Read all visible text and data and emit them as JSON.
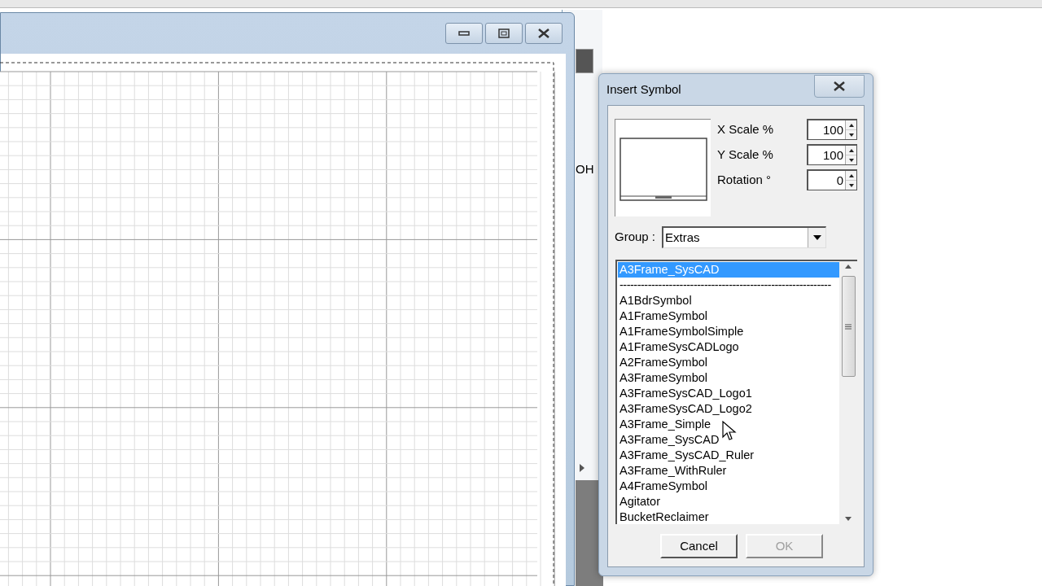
{
  "main_window": {
    "controls": [
      {
        "kind": "minimize"
      },
      {
        "kind": "maximize"
      },
      {
        "kind": "close"
      }
    ]
  },
  "background_window": {
    "text": "OH"
  },
  "dialog": {
    "title": "Insert Symbol",
    "fields": [
      {
        "label": "X Scale %",
        "value": "100"
      },
      {
        "label": "Y Scale %",
        "value": "100"
      },
      {
        "label": "Rotation °",
        "value": "0"
      }
    ],
    "group": {
      "label": "Group :",
      "value": "Extras"
    },
    "symbols": [
      {
        "kind": "item",
        "label": "A3Frame_SysCAD",
        "selected": true
      },
      {
        "kind": "separator",
        "label": "------------------------------------------------------------",
        "selected": false
      },
      {
        "kind": "item",
        "label": "A1BdrSymbol",
        "selected": false
      },
      {
        "kind": "item",
        "label": "A1FrameSymbol",
        "selected": false
      },
      {
        "kind": "item",
        "label": "A1FrameSymbolSimple",
        "selected": false
      },
      {
        "kind": "item",
        "label": "A1FrameSysCADLogo",
        "selected": false
      },
      {
        "kind": "item",
        "label": "A2FrameSymbol",
        "selected": false
      },
      {
        "kind": "item",
        "label": "A3FrameSymbol",
        "selected": false
      },
      {
        "kind": "item",
        "label": "A3FrameSysCAD_Logo1",
        "selected": false
      },
      {
        "kind": "item",
        "label": "A3FrameSysCAD_Logo2",
        "selected": false
      },
      {
        "kind": "item",
        "label": "A3Frame_Simple",
        "selected": false
      },
      {
        "kind": "item",
        "label": "A3Frame_SysCAD",
        "selected": false
      },
      {
        "kind": "item",
        "label": "A3Frame_SysCAD_Ruler",
        "selected": false
      },
      {
        "kind": "item",
        "label": "A3Frame_WithRuler",
        "selected": false
      },
      {
        "kind": "item",
        "label": "A4FrameSymbol",
        "selected": false
      },
      {
        "kind": "item",
        "label": "Agitator",
        "selected": false
      },
      {
        "kind": "item",
        "label": "BucketReclaimer",
        "selected": false
      }
    ],
    "buttons": [
      {
        "label": "Cancel",
        "disabled": false
      },
      {
        "label": "OK",
        "disabled": true
      }
    ]
  }
}
